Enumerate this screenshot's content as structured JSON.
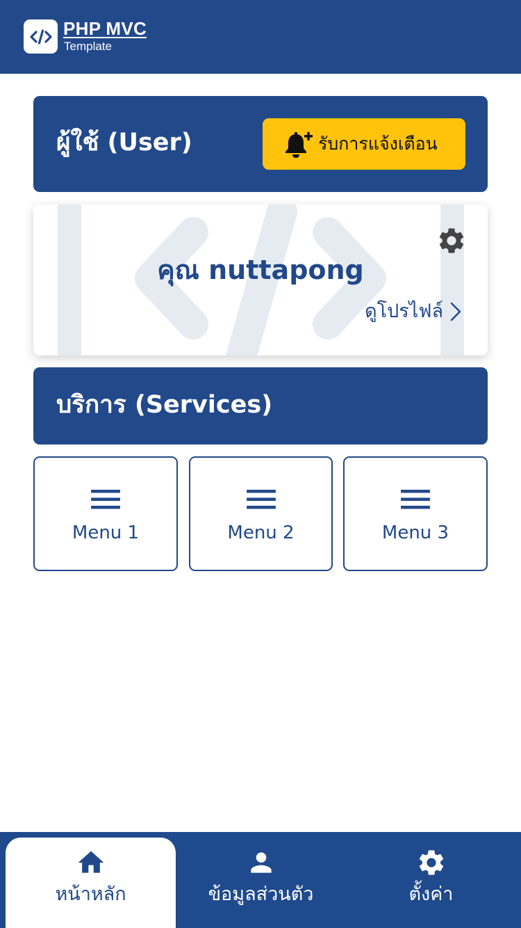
{
  "header": {
    "logo_title": "PHP MVC",
    "logo_subtitle": "Template",
    "logo_icon": "code-icon"
  },
  "user_section": {
    "title": "ผู้ใช้ (User)",
    "notify_button_label": "รับการแจ้งเตือน",
    "notify_icon": "bell-plus-icon"
  },
  "profile": {
    "name": "คุณ nuttapong",
    "link_label": "ดูโปรไฟล์",
    "settings_icon": "gear-icon"
  },
  "services": {
    "title": "บริการ (Services)",
    "menus": [
      {
        "label": "Menu 1",
        "icon": "hamburger-icon"
      },
      {
        "label": "Menu 2",
        "icon": "hamburger-icon"
      },
      {
        "label": "Menu 3",
        "icon": "hamburger-icon"
      }
    ]
  },
  "bottom_nav": {
    "items": [
      {
        "label": "หน้าหลัก",
        "icon": "home-icon",
        "active": true
      },
      {
        "label": "ข้อมูลส่วนตัว",
        "icon": "user-icon",
        "active": false
      },
      {
        "label": "ตั้งค่า",
        "icon": "gear-icon",
        "active": false
      }
    ]
  },
  "colors": {
    "primary": "#22498a",
    "accent": "#ffc30b",
    "background": "#ffffff",
    "watermark": "#e6ebf2"
  }
}
